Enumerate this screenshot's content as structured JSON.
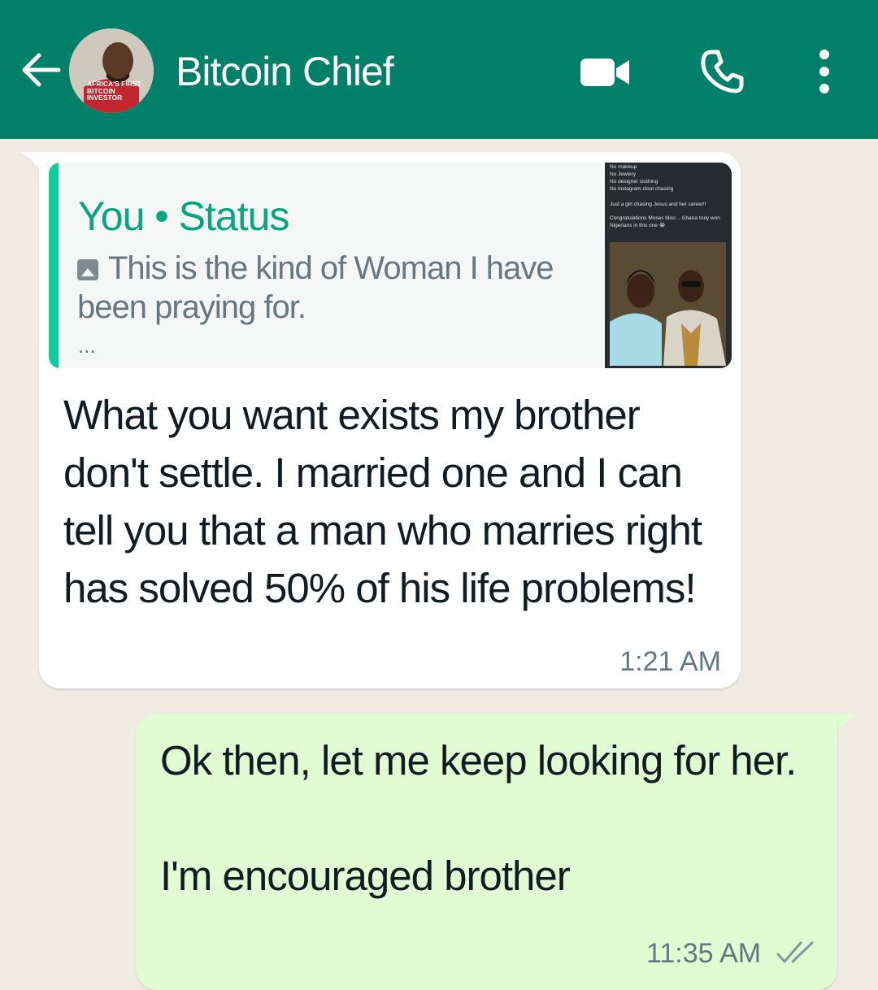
{
  "header": {
    "title": "Bitcoin Chief",
    "avatar_caption": "AFRICA'S FIRST BITCOIN INVESTOR",
    "background": "#008069",
    "icons": [
      "back-arrow-icon",
      "video-call-icon",
      "phone-icon",
      "more-options-icon"
    ]
  },
  "messages": {
    "incoming": {
      "quote": {
        "header": "You • Status",
        "text": "This is the kind of Woman I have been praying for.",
        "more": "...",
        "thumbnail_lines": [
          "No makeup",
          "No Jewlery",
          "No designer clothing",
          "No instagram clout chasing",
          "Just a girl chasing Jesus and her career!!",
          "Congratulations Moses bliss .. Ghana truly won Nigerians in this one 😭"
        ]
      },
      "text": "What you want exists my brother don't settle. I married one and I can tell you that a man who marries right has solved 50% of his life problems!",
      "time": "1:21 AM"
    },
    "outgoing": {
      "text": "Ok then, let me keep looking for her.\n\nI'm encouraged brother",
      "time": "11:35 AM",
      "status": "double-check-icon"
    }
  },
  "colors": {
    "chat_background": "#efeae2",
    "incoming_bubble": "#ffffff",
    "outgoing_bubble": "#e1fbd3",
    "quote_accent": "#06cf9c"
  }
}
